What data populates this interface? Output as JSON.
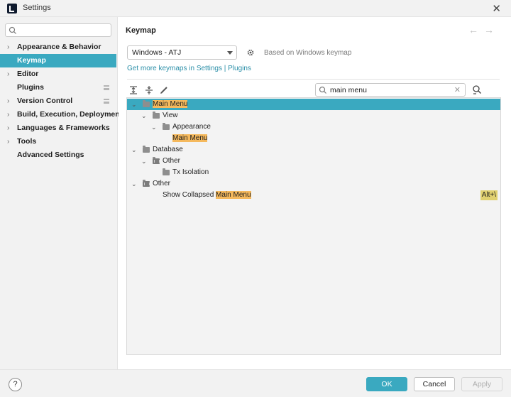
{
  "window": {
    "title": "Settings",
    "close_glyph": "✕"
  },
  "sidebar": {
    "search_placeholder": "",
    "items": [
      {
        "label": "Appearance & Behavior",
        "chevron": "›",
        "modified": false
      },
      {
        "label": "Keymap",
        "chevron": "",
        "modified": false,
        "active": true
      },
      {
        "label": "Editor",
        "chevron": "›",
        "modified": false
      },
      {
        "label": "Plugins",
        "chevron": "",
        "modified": true
      },
      {
        "label": "Version Control",
        "chevron": "›",
        "modified": true
      },
      {
        "label": "Build, Execution, Deployment",
        "chevron": "›",
        "modified": false
      },
      {
        "label": "Languages & Frameworks",
        "chevron": "›",
        "modified": false
      },
      {
        "label": "Tools",
        "chevron": "›",
        "modified": false
      },
      {
        "label": "Advanced Settings",
        "chevron": "",
        "modified": false
      }
    ]
  },
  "main": {
    "title": "Keymap",
    "back_glyph": "←",
    "forward_glyph": "→",
    "keymap_selected": "Windows - ATJ",
    "based_on": "Based on Windows keymap",
    "link_keymaps": "Get more keymaps in Settings",
    "link_sep": " | ",
    "link_plugins": "Plugins",
    "search_value": "main menu",
    "search_clear": "✕"
  },
  "tree": [
    {
      "pre": "",
      "hl": "Main Menu",
      "post": "",
      "chevron": "⌄",
      "icon": "folder",
      "selected": true
    },
    {
      "pre": "View",
      "hl": "",
      "post": "",
      "chevron": "⌄",
      "icon": "folder"
    },
    {
      "pre": "Appearance",
      "hl": "",
      "post": "",
      "chevron": "⌄",
      "icon": "folder"
    },
    {
      "pre": "",
      "hl": "Main Menu",
      "post": "",
      "chevron": "",
      "icon": ""
    },
    {
      "pre": "Database",
      "hl": "",
      "post": "",
      "chevron": "⌄",
      "icon": "folder"
    },
    {
      "pre": "Other",
      "hl": "",
      "post": "",
      "chevron": "⌄",
      "icon": "grid"
    },
    {
      "pre": "Tx Isolation",
      "hl": "",
      "post": "",
      "chevron": "",
      "icon": "folder"
    },
    {
      "pre": "Other",
      "hl": "",
      "post": "",
      "chevron": "⌄",
      "icon": "grid"
    },
    {
      "pre": "Show Collapsed ",
      "hl": "Main Menu",
      "post": "",
      "chevron": "",
      "icon": "",
      "shortcut": "Alt+\\"
    }
  ],
  "footer": {
    "help": "?",
    "ok": "OK",
    "cancel": "Cancel",
    "apply": "Apply"
  },
  "colors": {
    "accent": "#3aa9c0",
    "highlight": "#f5b95d",
    "shortcut_bg": "#e0d070"
  }
}
